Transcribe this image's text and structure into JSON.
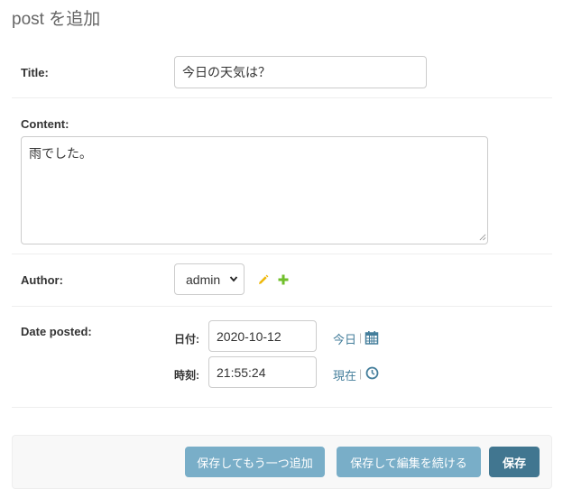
{
  "page": {
    "title": "post を追加"
  },
  "fields": {
    "title": {
      "label": "Title:",
      "value": "今日の天気は？"
    },
    "content": {
      "label": "Content:",
      "value": "雨でした。"
    },
    "author": {
      "label": "Author:",
      "selected": "admin",
      "edit_icon": "pencil-icon",
      "add_icon": "plus-icon"
    },
    "date_posted": {
      "label": "Date posted:",
      "date": {
        "label": "日付:",
        "value": "2020-10-12",
        "shortcut": "今日",
        "separator": "|",
        "icon": "calendar-icon"
      },
      "time": {
        "label": "時刻:",
        "value": "21:55:24",
        "shortcut": "現在",
        "separator": "|",
        "icon": "clock-icon"
      }
    }
  },
  "buttons": {
    "save_add_another": "保存してもう一つ追加",
    "save_continue": "保存して編集を続ける",
    "save": "保存"
  },
  "colors": {
    "link": "#447e9b",
    "button_secondary": "#79aec8",
    "button_primary": "#417690",
    "pencil": "#efb80b",
    "plus": "#70bf2b"
  }
}
